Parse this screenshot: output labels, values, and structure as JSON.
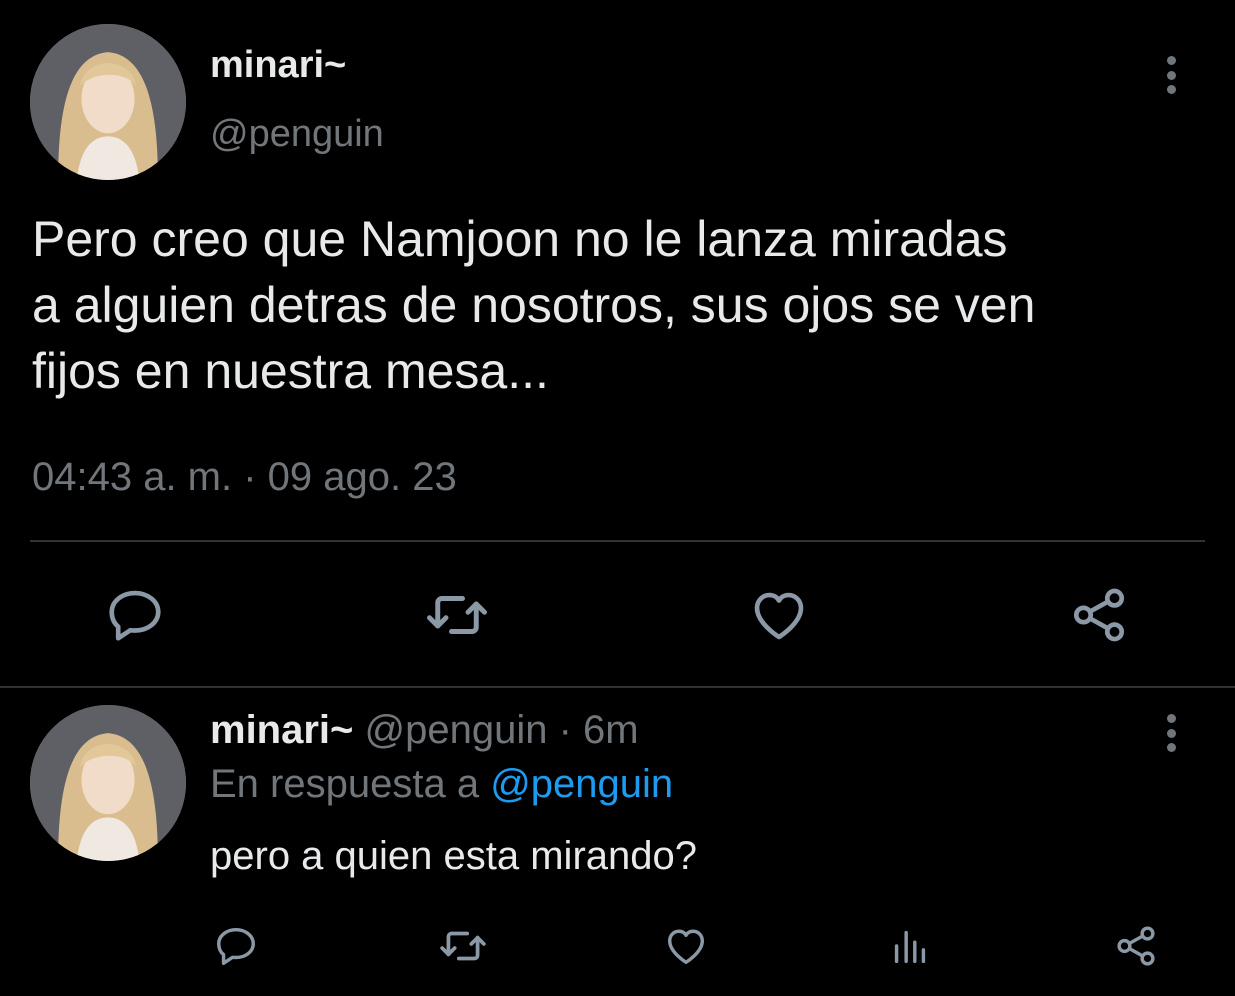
{
  "colors": {
    "background": "#000000",
    "text_primary": "#e7e9ea",
    "text_secondary": "#71767b",
    "link": "#1d9bf0",
    "divider": "#2f3336"
  },
  "main_tweet": {
    "display_name": "minari~",
    "handle": "@penguin",
    "text": "Pero creo que Namjoon no le lanza miradas\na alguien detras de nosotros, sus ojos se ven\nfijos en nuestra mesa...",
    "timestamp": "04:43 a. m. · 09 ago. 23",
    "actions": [
      "reply-icon",
      "retweet-icon",
      "like-icon",
      "share-icon"
    ],
    "more_icon": "more-vertical-icon"
  },
  "reply_tweet": {
    "display_name": "minari~",
    "handle": "@penguin",
    "separator": " · ",
    "time_ago": "6m",
    "reply_prefix": "En respuesta a ",
    "reply_to": "@penguin",
    "text": "pero a quien esta mirando?",
    "actions": [
      "reply-icon",
      "retweet-icon",
      "like-icon",
      "analytics-icon",
      "share-icon"
    ],
    "more_icon": "more-vertical-icon"
  }
}
